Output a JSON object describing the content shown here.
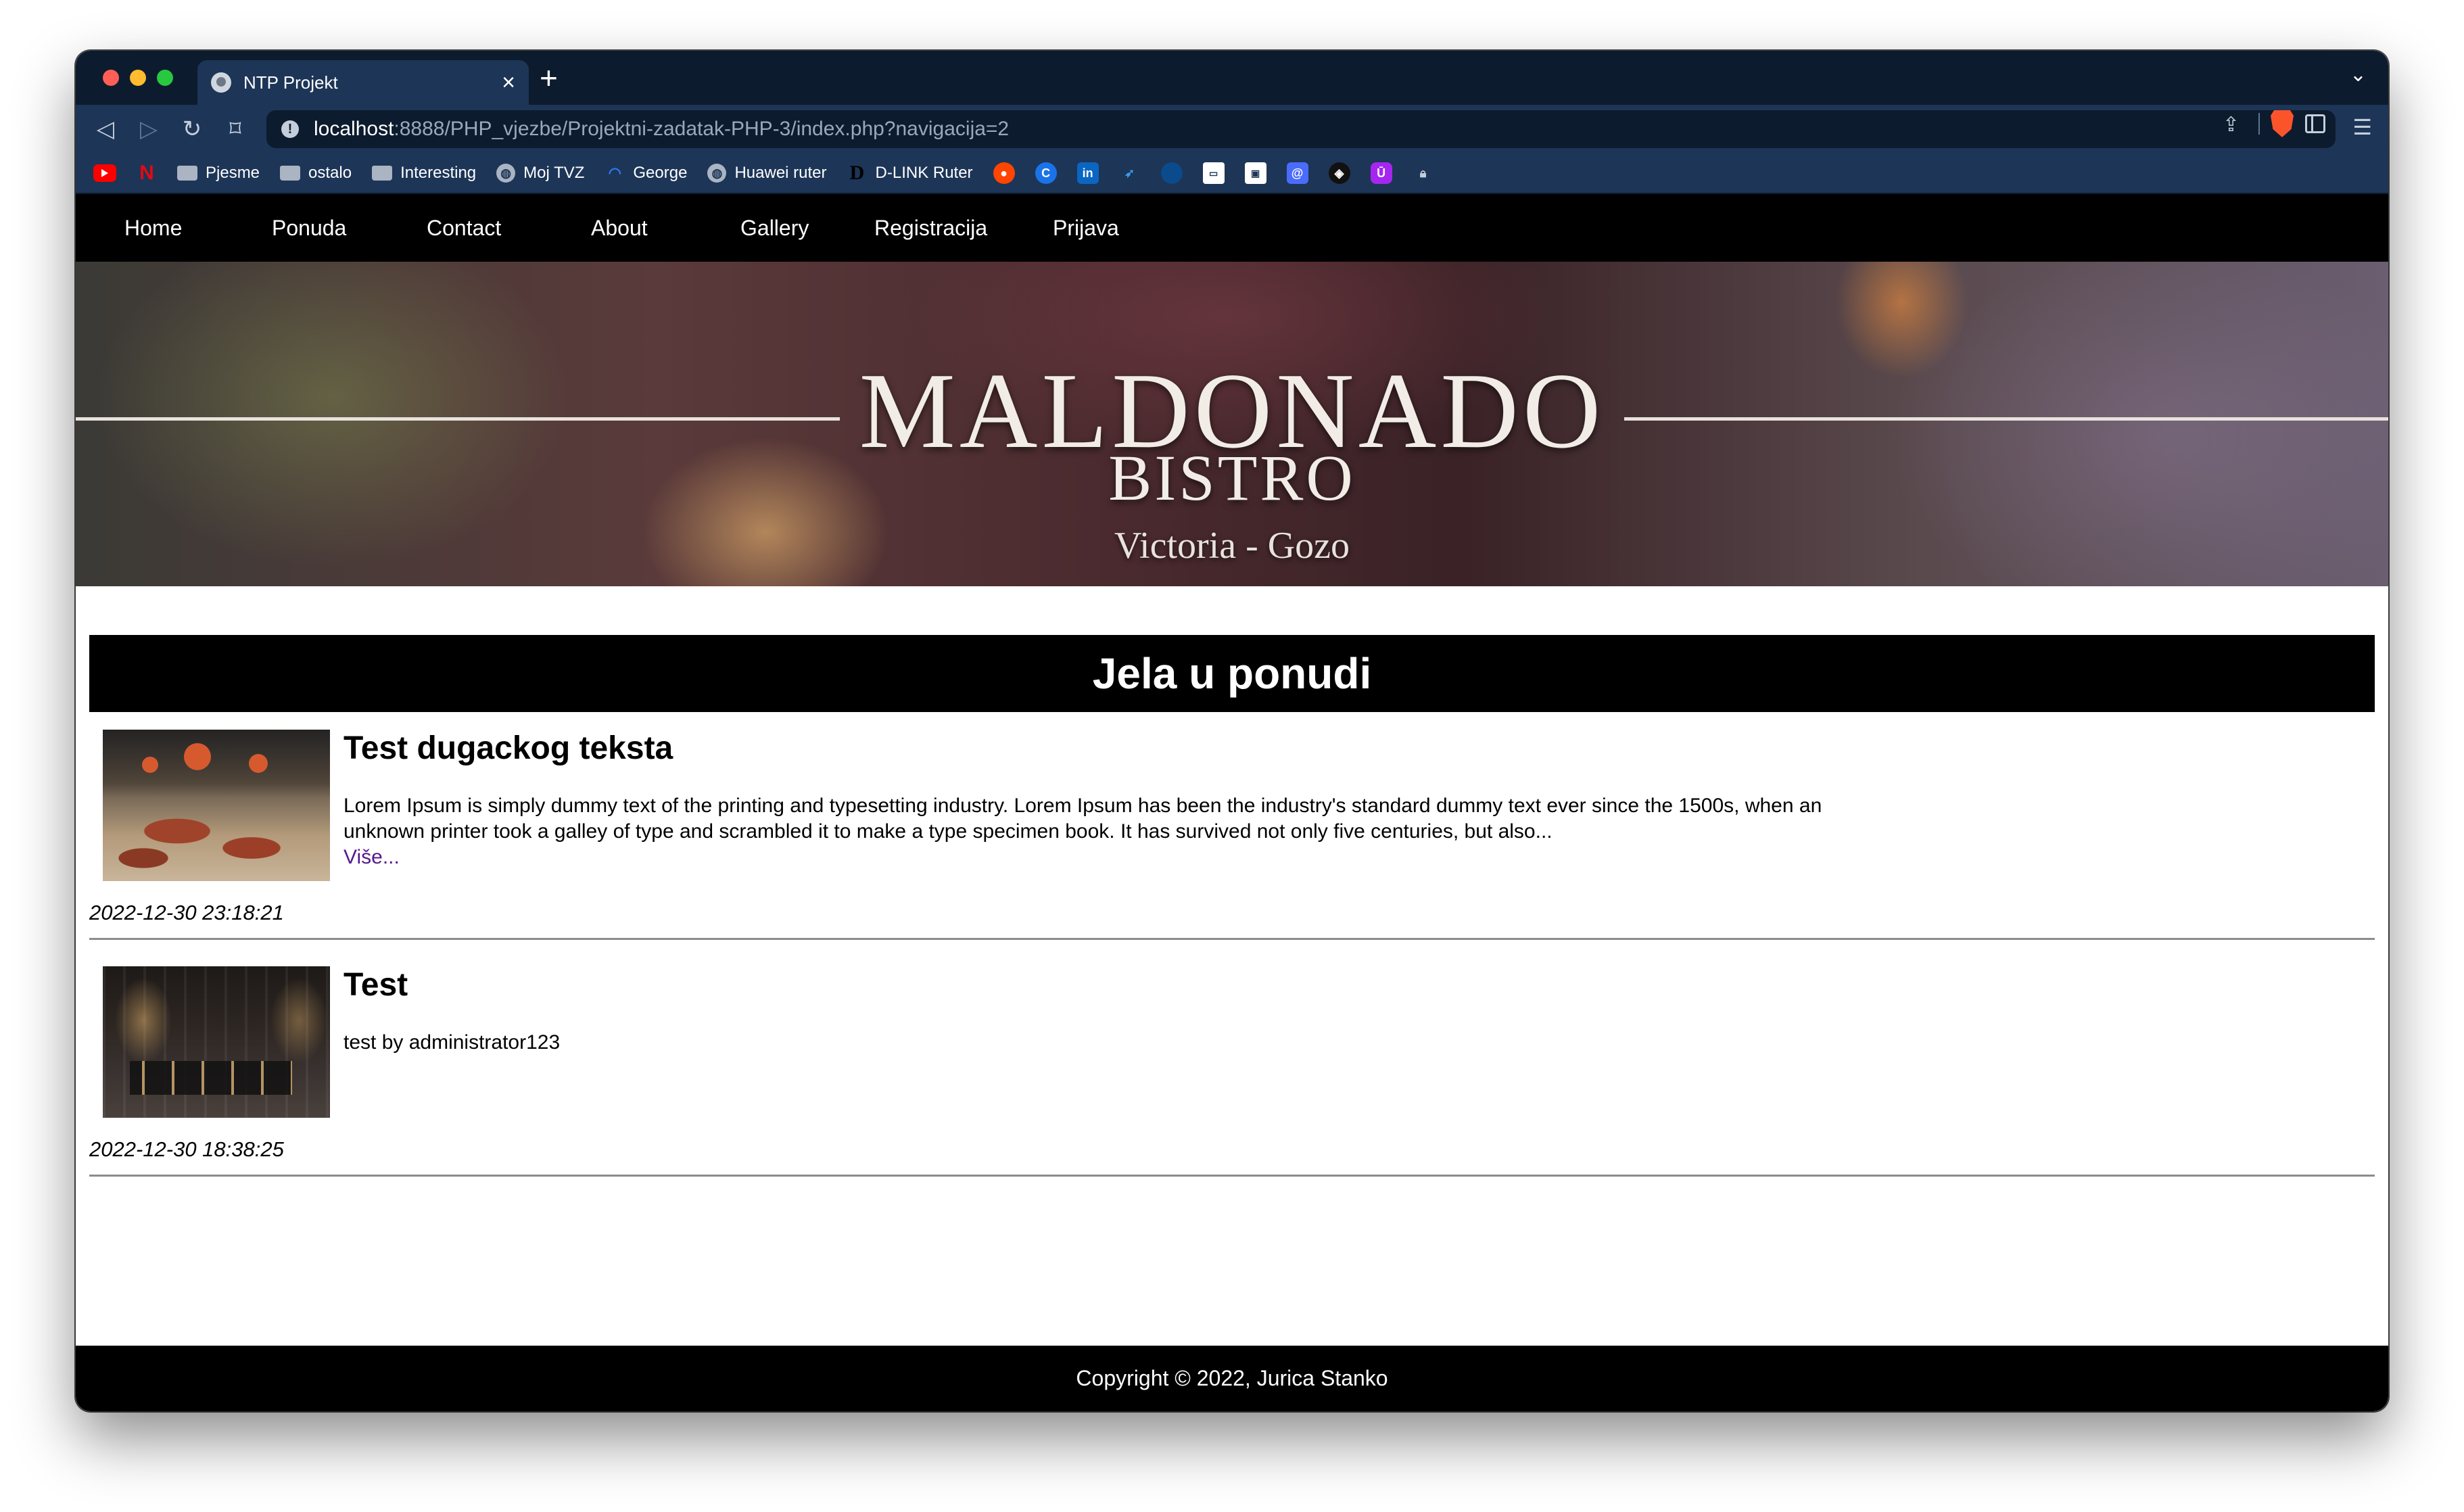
{
  "browser": {
    "tab_title": "NTP Projekt",
    "url_host": "localhost",
    "url_rest": ":8888/PHP_vjezbe/Projektni-zadatak-PHP-3/index.php?navigacija=2",
    "bookmarks": [
      {
        "label": "",
        "icon": "youtube-icon"
      },
      {
        "label": "",
        "icon": "netflix-icon"
      },
      {
        "label": "Pjesme",
        "icon": "folder-icon"
      },
      {
        "label": "ostalo",
        "icon": "folder-icon"
      },
      {
        "label": "Interesting",
        "icon": "folder-icon"
      },
      {
        "label": "Moj TVZ",
        "icon": "globe-icon"
      },
      {
        "label": "George",
        "icon": "george-icon"
      },
      {
        "label": "Huawei ruter",
        "icon": "globe-icon"
      },
      {
        "label": "D-LINK Ruter",
        "icon": "dlink-icon"
      }
    ],
    "extension_icons": [
      "reddit-icon",
      "c-icon",
      "linkedin-icon",
      "bird-icon",
      "blue-icon",
      "tv-icon",
      "monitor-icon",
      "at-icon",
      "dark-icon",
      "purple-icon",
      "lock-icon"
    ]
  },
  "site": {
    "nav": [
      "Home",
      "Ponuda",
      "Contact",
      "About",
      "Gallery",
      "Registracija",
      "Prijava"
    ],
    "hero": {
      "title": "MALDONADO",
      "subtitle": "BISTRO",
      "location": "Victoria - Gozo"
    },
    "section_title": "Jela u ponudi",
    "articles": [
      {
        "title": "Test dugackog teksta",
        "text": "Lorem Ipsum is simply dummy text of the printing and typesetting industry. Lorem Ipsum has been the industry's standard dummy text ever since the 1500s, when an unknown printer took a galley of type and scrambled it to make a type specimen book. It has survived not only five centuries, but also...",
        "more": "Više...",
        "date": "2022-12-30 23:18:21"
      },
      {
        "title": "Test",
        "text": "test by administrator123",
        "date": "2022-12-30 18:38:25"
      }
    ],
    "footer": "Copyright © 2022, Jurica Stanko"
  }
}
